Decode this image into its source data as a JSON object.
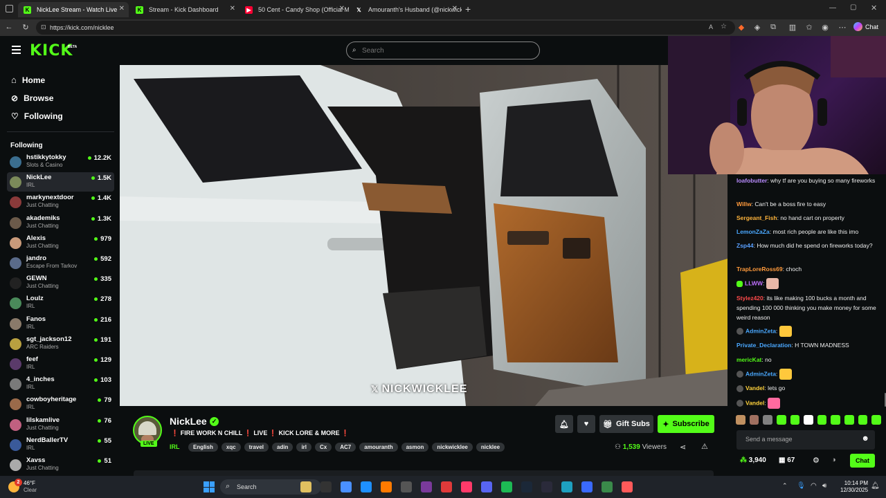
{
  "browser": {
    "tabs": [
      {
        "title": "NickLee Stream - Watch Live",
        "color": "#53fc18"
      },
      {
        "title": "Stream - Kick Dashboard",
        "color": "#53fc18"
      },
      {
        "title": "50 Cent - Candy Shop (Official Mu",
        "color": "#ff0033"
      },
      {
        "title": "Amouranth's Husband (@nickwick",
        "color": "#ffffff"
      }
    ],
    "url": "https://kick.com/nicklee",
    "copilot_label": "Chat"
  },
  "header": {
    "logo_text": "KICK",
    "logo_badge": "BETA",
    "search_placeholder": "Search"
  },
  "sidebar": {
    "nav": [
      {
        "label": "Home",
        "icon": "home-icon"
      },
      {
        "label": "Browse",
        "icon": "compass-icon"
      },
      {
        "label": "Following",
        "icon": "heart-icon"
      }
    ],
    "following_title": "Following",
    "channels": [
      {
        "name": "hstikkytokky",
        "category": "Slots & Casino",
        "viewers": "12.2K",
        "color": "#3b6e8f"
      },
      {
        "name": "NickLee",
        "category": "IRL",
        "viewers": "1.5K",
        "color": "#7b8a5a"
      },
      {
        "name": "markynextdoor",
        "category": "Just Chatting",
        "viewers": "1.4K",
        "color": "#8a3a3a"
      },
      {
        "name": "akademiks",
        "category": "Just Chatting",
        "viewers": "1.3K",
        "color": "#6b5a4a"
      },
      {
        "name": "Alexis",
        "category": "Just Chatting",
        "viewers": "979",
        "color": "#c99a7a"
      },
      {
        "name": "jandro",
        "category": "Escape From Tarkov",
        "viewers": "592",
        "color": "#5a6b8a"
      },
      {
        "name": "GEWN",
        "category": "Just Chatting",
        "viewers": "335",
        "color": "#222222"
      },
      {
        "name": "Loulz",
        "category": "IRL",
        "viewers": "278",
        "color": "#4a8a5a"
      },
      {
        "name": "Fanos",
        "category": "IRL",
        "viewers": "216",
        "color": "#8a7a6a"
      },
      {
        "name": "sgt_jackson12",
        "category": "ARC Raiders",
        "viewers": "191",
        "color": "#b8a040"
      },
      {
        "name": "feef",
        "category": "IRL",
        "viewers": "129",
        "color": "#5a3a6a"
      },
      {
        "name": "4_inches",
        "category": "IRL",
        "viewers": "103",
        "color": "#7a7a7a"
      },
      {
        "name": "cowboyheritage",
        "category": "IRL",
        "viewers": "79",
        "color": "#9a6a4a"
      },
      {
        "name": "lilskamlive",
        "category": "Just Chatting",
        "viewers": "76",
        "color": "#c06080"
      },
      {
        "name": "NerdBallerTV",
        "category": "IRL",
        "viewers": "55",
        "color": "#3a5a9a"
      },
      {
        "name": "Xavss",
        "category": "Just Chatting",
        "viewers": "51",
        "color": "#aaaaaa"
      }
    ]
  },
  "video": {
    "watermark": "NICKWICKLEE"
  },
  "stream": {
    "name": "NickLee",
    "live_badge": "LIVE",
    "title_parts": [
      "FIRE WORK N CHILL",
      "LIVE",
      "KICK LORE & MORE"
    ],
    "title_separator": "❗",
    "category": "IRL",
    "tags": [
      "English",
      "xqc",
      "travel",
      "adin",
      "irl",
      "Cx",
      "AC7",
      "amouranth",
      "asmon",
      "nickwicklee",
      "nicklee"
    ],
    "gift_label": "Gift Subs",
    "subscribe_label": "Subscribe",
    "viewers": "1,539",
    "viewers_label": "Viewers"
  },
  "chat": {
    "messages": [
      {
        "user": "loafobutter",
        "color": "#b98cff",
        "text": "why tf are you buying so many fireworks"
      },
      {
        "user": "Willw",
        "color": "#ff9a3c",
        "text": "Can't be a boss fire to easy"
      },
      {
        "user": "Sergeant_Fish",
        "color": "#ffb43c",
        "text": "no hand cart on property"
      },
      {
        "user": "LemonZaZa",
        "color": "#4aa8ff",
        "text": "most rich people are like this imo"
      },
      {
        "user": "Zsp44",
        "color": "#5aa0ff",
        "text": "How much did he spend on fireworks today?"
      },
      {
        "user": "TrapLoreRoss69",
        "color": "#ff9a3c",
        "text": "choch"
      },
      {
        "user": "LLWW",
        "color": "#c070ff",
        "text": ""
      },
      {
        "user": "Stylez420",
        "color": "#ff4a4a",
        "text": "its like making 100 bucks a month and spending 100 000 thinking you make money for some weird reason"
      },
      {
        "user": "AdminZeta",
        "color": "#4aa8ff",
        "text": ""
      },
      {
        "user": "Private_Declaration",
        "color": "#4aa8ff",
        "text": "H TOWN MADNESS"
      },
      {
        "user": "mericKat",
        "color": "#53fc18",
        "text": "no"
      },
      {
        "user": "AdminZeta",
        "color": "#4aa8ff",
        "text": ""
      },
      {
        "user": "Vandel",
        "color": "#ffd23c",
        "text": "lets go"
      },
      {
        "user": "Vandel",
        "color": "#ffd23c",
        "text": ""
      }
    ],
    "input_placeholder": "Send a message",
    "points": "3,940",
    "gifts": "67",
    "send_label": "Chat"
  },
  "taskbar": {
    "weather_temp": "46°F",
    "weather_desc": "Clear",
    "weather_badge": "2",
    "search_label": "Search",
    "time": "10:14 PM",
    "date": "12/30/2025"
  },
  "colors": {
    "accent": "#53fc18",
    "bg": "#0b0e0f",
    "panel": "#24272c"
  }
}
